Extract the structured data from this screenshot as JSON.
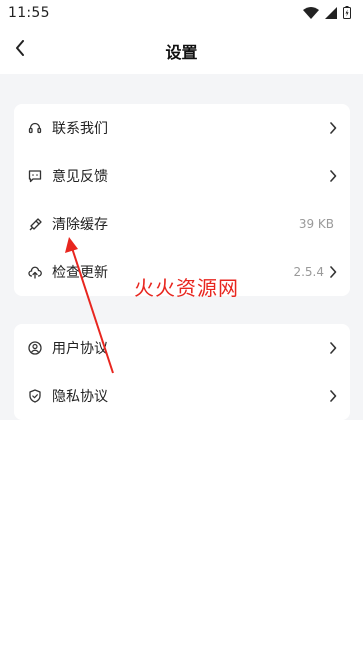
{
  "status_bar": {
    "time": "11:55"
  },
  "header": {
    "title": "设置"
  },
  "group1": [
    {
      "label": "联系我们",
      "value": ""
    },
    {
      "label": "意见反馈",
      "value": ""
    },
    {
      "label": "清除缓存",
      "value": "39 KB"
    },
    {
      "label": "检查更新",
      "value": "2.5.4"
    }
  ],
  "group2": [
    {
      "label": "用户协议"
    },
    {
      "label": "隐私协议"
    }
  ],
  "watermark": "火火资源网",
  "colors": {
    "background": "#f4f5f7",
    "card": "#ffffff",
    "annotation_red": "#e8261f"
  }
}
